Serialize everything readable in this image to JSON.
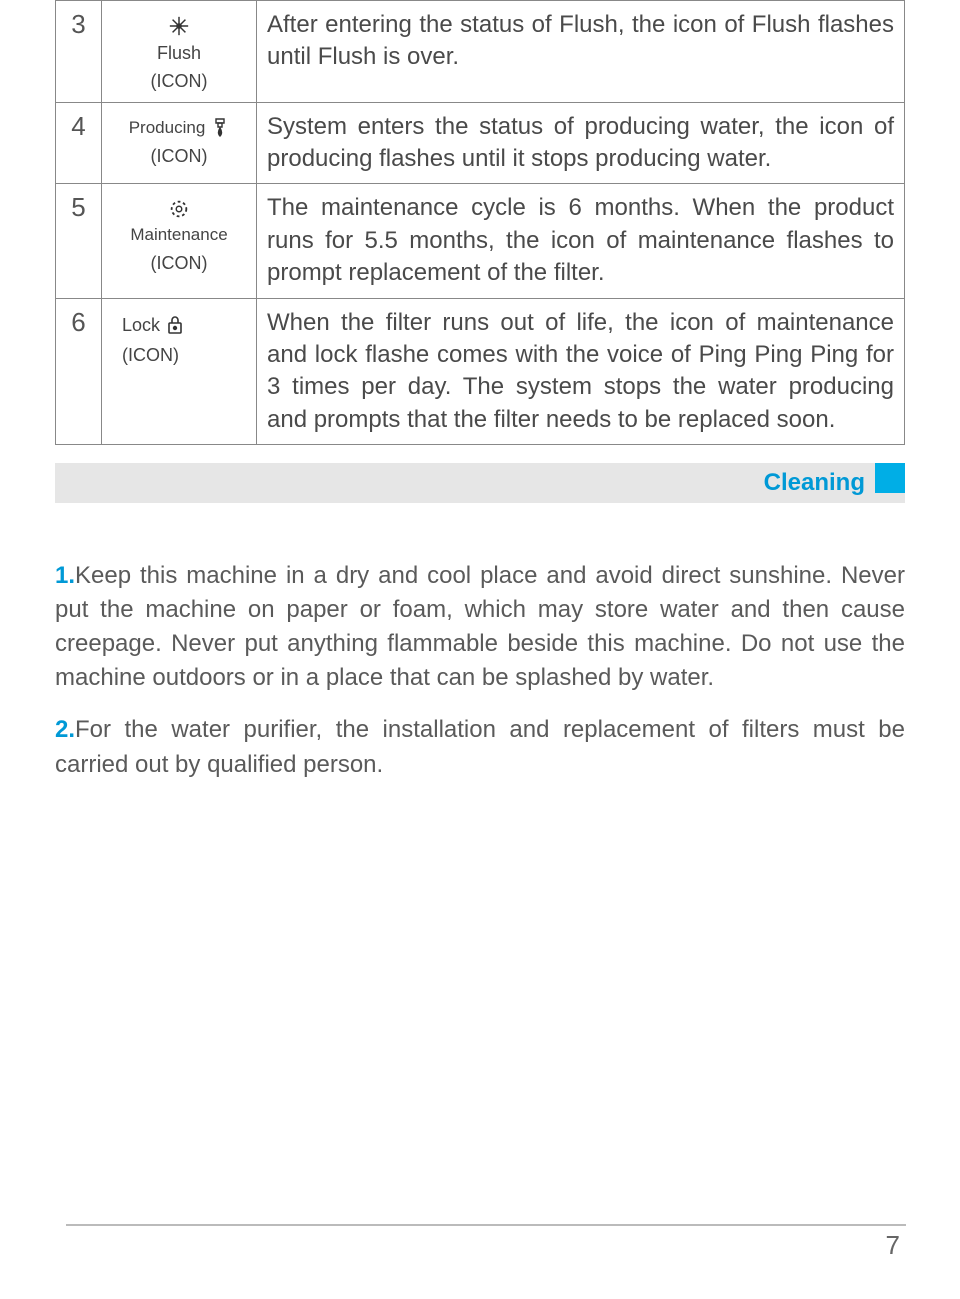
{
  "rows": [
    {
      "num": "3",
      "label_top": "Flush",
      "label_bottom": "(ICON)",
      "icon": "flush-icon",
      "layout": "stack",
      "desc": "After entering the status of Flush, the icon of Flush flashes until Flush is over."
    },
    {
      "num": "4",
      "label_top": "Producing",
      "label_bottom": "(ICON)",
      "icon": "producing-icon",
      "layout": "row",
      "desc": "System enters the status of producing water, the icon of producing flashes until it stops producing water."
    },
    {
      "num": "5",
      "label_top": "Maintenance",
      "label_bottom": "(ICON)",
      "icon": "maintenance-icon",
      "layout": "stack",
      "desc": "The maintenance cycle is 6 months. When the product runs for 5.5 months, the icon of maintenance flashes to prompt replacement of the filter."
    },
    {
      "num": "6",
      "label_top": "Lock",
      "label_bottom": "(ICON)",
      "icon": "lock-icon",
      "layout": "row",
      "desc": "When the filter runs out of life, the icon of maintenance and lock flashe comes with the voice of Ping Ping Ping for 3 times per day. The system stops the water producing and prompts that the filter needs to be replaced soon."
    }
  ],
  "section_title": "Cleaning",
  "paragraphs": [
    {
      "lead": "1.",
      "text": "Keep this machine in a dry and cool place and avoid direct sunshine. Never put the machine on paper or foam, which may store water and then cause creepage. Never put anything flammable beside this machine. Do not use the machine outdoors or in a place that can be splashed by water."
    },
    {
      "lead": "2.",
      "text": "For the water purifier, the installation and replacement of filters must be carried out by qualified person."
    }
  ],
  "page_number": "7"
}
